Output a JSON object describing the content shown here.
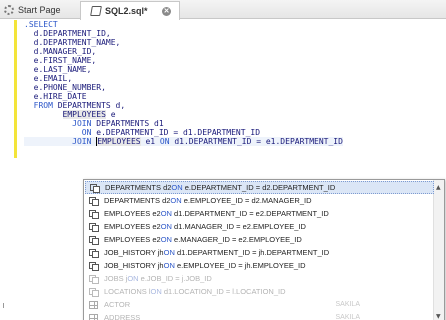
{
  "tabs": [
    {
      "label": "Start Page",
      "icon": "gear-icon",
      "active": false
    },
    {
      "label": "SQL2.sql*",
      "icon": "sql-file-icon",
      "active": true
    }
  ],
  "editor": {
    "lines": [
      [
        {
          "t": ".SELECT",
          "k": true
        }
      ],
      [
        {
          "t": "  d.DEPARTMENT_ID,"
        }
      ],
      [
        {
          "t": "  d.DEPARTMENT_NAME,"
        }
      ],
      [
        {
          "t": "  d.MANAGER_ID,"
        }
      ],
      [
        {
          "t": "  e.FIRST_NAME,"
        }
      ],
      [
        {
          "t": "  e.LAST_NAME,"
        }
      ],
      [
        {
          "t": "  e.EMAIL,"
        }
      ],
      [
        {
          "t": "  e.PHONE_NUMBER,"
        }
      ],
      [
        {
          "t": "  e.HIRE_DATE"
        }
      ],
      [
        {
          "t": "  "
        },
        {
          "t": "FROM",
          "k": true
        },
        {
          "t": " DEPARTMENTS d,"
        }
      ],
      [
        {
          "t": "        "
        },
        {
          "t": "EMPLOYEES",
          "hl": true
        },
        {
          "t": " e"
        }
      ],
      [
        {
          "t": "          "
        },
        {
          "t": "JOIN",
          "k": true
        },
        {
          "t": " DEPARTMENTS d1"
        }
      ],
      [
        {
          "t": "            "
        },
        {
          "t": "ON",
          "k": true
        },
        {
          "t": " e.DEPARTMENT_ID = d1.DEPARTMENT_ID"
        }
      ],
      [
        {
          "t": "          "
        },
        {
          "t": "JOIN",
          "k": true
        },
        {
          "t": " "
        },
        {
          "t": "EMPLOYEES",
          "hl": true,
          "cursor": true
        },
        {
          "t": " e1 "
        },
        {
          "t": "ON",
          "k": true
        },
        {
          "t": " d1.DEPARTMENT_ID = e1.DEPARTMENT_ID"
        }
      ]
    ]
  },
  "autocomplete": {
    "items": [
      {
        "pre": "DEPARTMENTS d2 ",
        "kw": "ON",
        "post": " e.DEPARTMENT_ID = d2.DEPARTMENT_ID",
        "icon": "join-icon",
        "selected": true
      },
      {
        "pre": "DEPARTMENTS d2 ",
        "kw": "ON",
        "post": " e.EMPLOYEE_ID = d2.MANAGER_ID",
        "icon": "join-icon"
      },
      {
        "pre": "EMPLOYEES e2 ",
        "kw": "ON",
        "post": " d1.DEPARTMENT_ID = e2.DEPARTMENT_ID",
        "icon": "join-icon"
      },
      {
        "pre": "EMPLOYEES e2 ",
        "kw": "ON",
        "post": " d1.MANAGER_ID = e2.EMPLOYEE_ID",
        "icon": "join-icon"
      },
      {
        "pre": "EMPLOYEES e2 ",
        "kw": "ON",
        "post": " e.MANAGER_ID = e2.EMPLOYEE_ID",
        "icon": "join-icon"
      },
      {
        "pre": "JOB_HISTORY jh ",
        "kw": "ON",
        "post": " d1.DEPARTMENT_ID = jh.DEPARTMENT_ID",
        "icon": "join-icon"
      },
      {
        "pre": "JOB_HISTORY jh ",
        "kw": "ON",
        "post": " e.EMPLOYEE_ID = jh.EMPLOYEE_ID",
        "icon": "join-icon"
      },
      {
        "pre": "JOBS j ",
        "kw": "ON",
        "post": " e.JOB_ID = j.JOB_ID",
        "icon": "join-icon",
        "faded": true
      },
      {
        "pre": "LOCATIONS l ",
        "kw": "ON",
        "post": " d1.LOCATION_ID = l.LOCATION_ID",
        "icon": "join-icon",
        "faded": true
      },
      {
        "pre": "ACTOR",
        "kw": "",
        "post": "",
        "schema": "SAKILA",
        "icon": "table-icon",
        "faded": true
      },
      {
        "pre": "ADDRESS",
        "kw": "",
        "post": "",
        "schema": "SAKILA",
        "icon": "table-icon",
        "faded": true
      }
    ]
  },
  "icons": {
    "scroll_up": "▲",
    "scroll_down": "▼",
    "close": "✕"
  }
}
